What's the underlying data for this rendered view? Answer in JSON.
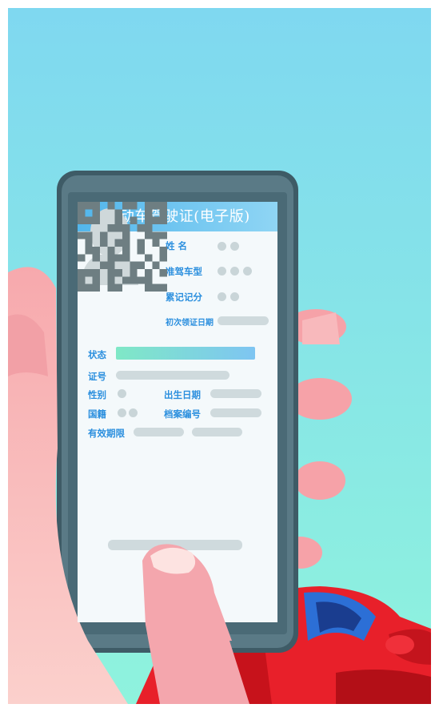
{
  "card": {
    "title": "机动车驾驶证(电子版)",
    "fields": {
      "name": "姓 名",
      "vehicle_class": "准驾车型",
      "points": "累记记分",
      "first_issue_date": "初次领证日期",
      "status": "状态",
      "license_no": "证号",
      "gender": "性别",
      "birth_date": "出生日期",
      "nationality": "国籍",
      "file_no": "档案编号",
      "valid_period": "有效期限"
    }
  },
  "colors": {
    "background_top": "#7fd8f0",
    "background_bottom": "#8ff3dd",
    "phone_frame": "#4e6e79",
    "card_header": "#52b6ec",
    "label_blue": "#2b8fde",
    "placeholder_gray": "#cfdadd",
    "car_red": "#e8202a",
    "skin": "#f6b7b7"
  },
  "icons": [
    "person-silhouette-icon",
    "qr-code-icon"
  ]
}
